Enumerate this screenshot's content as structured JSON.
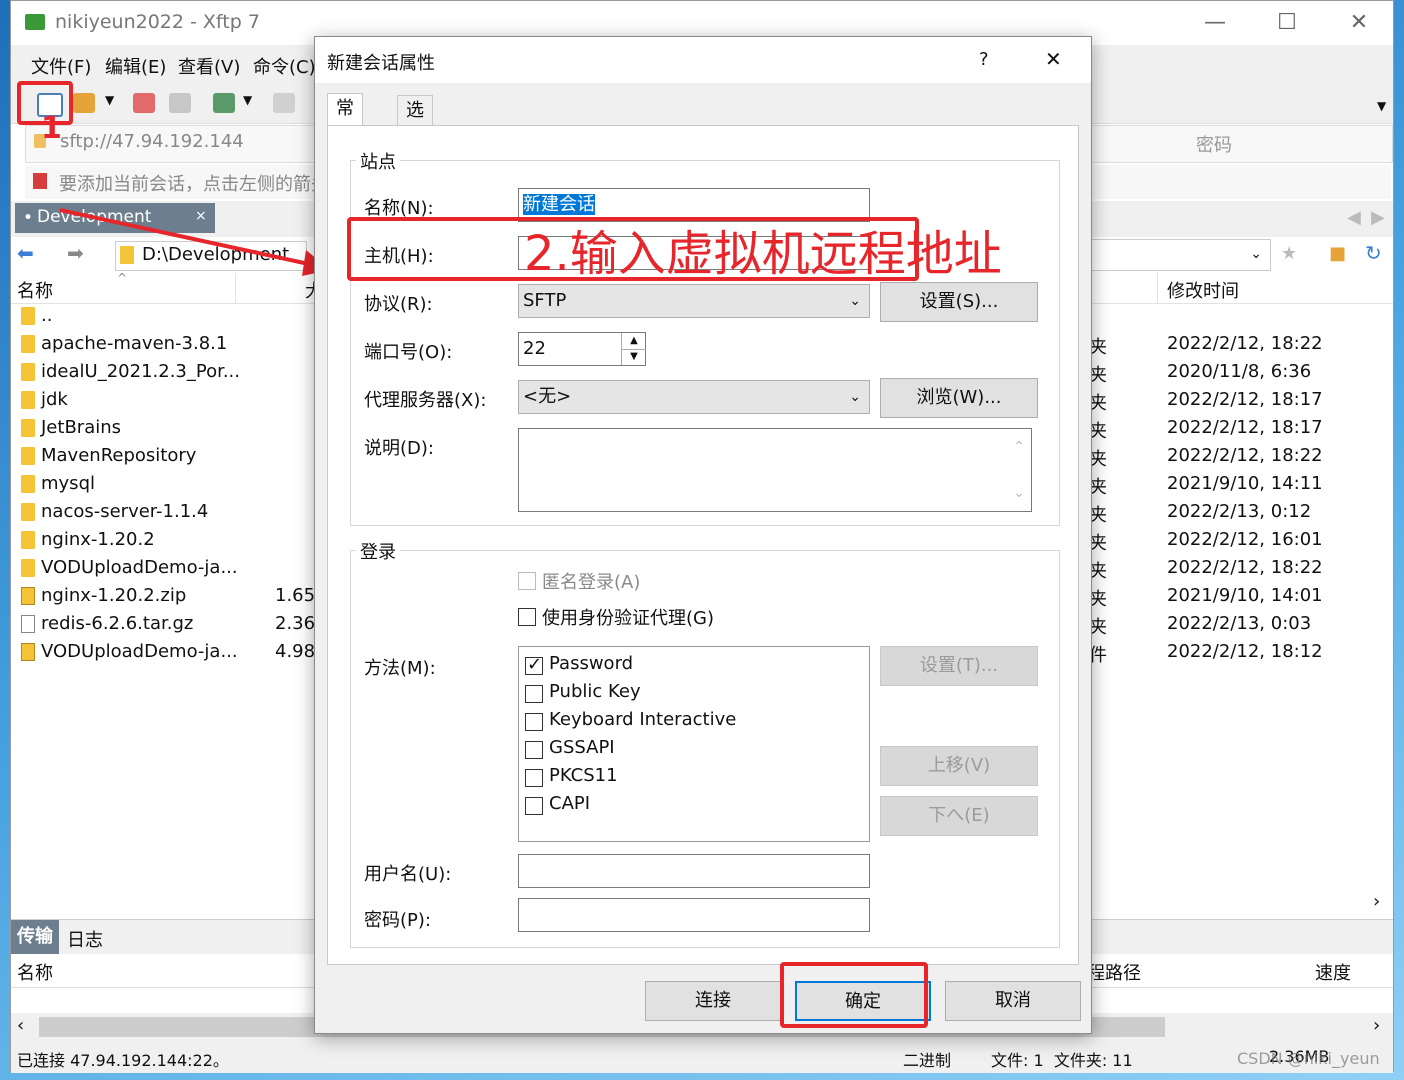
{
  "window": {
    "title": "nikiyeun2022 - Xftp 7",
    "minimize": "—",
    "maximize": "☐",
    "close": "✕"
  },
  "menu": [
    "文件(F)",
    "编辑(E)",
    "查看(V)",
    "命令(C)"
  ],
  "address": {
    "value": "sftp://47.94.192.144",
    "password_placeholder": "密码"
  },
  "info_bar": "要添加当前会话，点击左侧的箭头",
  "session_tab": {
    "label": "Development",
    "close": "×"
  },
  "path": "D:\\Development",
  "left_columns": {
    "name": "名称",
    "size": "大"
  },
  "right_columns": {
    "modified": "修改时间"
  },
  "files": [
    {
      "name": "..",
      "size": "",
      "type": "",
      "modified": "",
      "icon": "folder"
    },
    {
      "name": "apache-maven-3.8.1",
      "size": "",
      "type": "夹",
      "modified": "2022/2/12, 18:22",
      "icon": "folder"
    },
    {
      "name": "idealU_2021.2.3_Por...",
      "size": "",
      "type": "夹",
      "modified": "2020/11/8, 6:36",
      "icon": "folder"
    },
    {
      "name": "jdk",
      "size": "",
      "type": "夹",
      "modified": "2022/2/12, 18:17",
      "icon": "folder"
    },
    {
      "name": "JetBrains",
      "size": "",
      "type": "夹",
      "modified": "2022/2/12, 18:17",
      "icon": "folder"
    },
    {
      "name": "MavenRepository",
      "size": "",
      "type": "夹",
      "modified": "2022/2/12, 18:22",
      "icon": "folder"
    },
    {
      "name": "mysql",
      "size": "",
      "type": "夹",
      "modified": "2021/9/10, 14:11",
      "icon": "folder"
    },
    {
      "name": "nacos-server-1.1.4",
      "size": "",
      "type": "夹",
      "modified": "2022/2/13, 0:12",
      "icon": "folder"
    },
    {
      "name": "nginx-1.20.2",
      "size": "",
      "type": "夹",
      "modified": "2022/2/12, 16:01",
      "icon": "folder"
    },
    {
      "name": "VODUploadDemo-ja...",
      "size": "",
      "type": "夹",
      "modified": "2022/2/12, 18:22",
      "icon": "folder"
    },
    {
      "name": "nginx-1.20.2.zip",
      "size": "1.65",
      "type": "夹",
      "modified": "2021/9/10, 14:01",
      "icon": "zip"
    },
    {
      "name": "redis-6.2.6.tar.gz",
      "size": "2.36",
      "type": "夹",
      "modified": "2022/2/13, 0:03",
      "icon": "file"
    },
    {
      "name": "VODUploadDemo-ja...",
      "size": "4.98",
      "type": "件",
      "modified": "2022/2/12, 18:12",
      "icon": "zip"
    }
  ],
  "bottom_tabs": [
    "传输",
    "日志"
  ],
  "transfer_columns": {
    "name": "名称",
    "path": "程路径",
    "speed": "速度"
  },
  "status": {
    "connected": "已连接 47.94.192.144:22。",
    "mode": "二进制",
    "counts": "文件: 1  文件夹: 11",
    "size": "2.36MB"
  },
  "watermark": "CSDN @niki_yeun",
  "annotations": {
    "step1": "1",
    "step2": "2.输入虚拟机远程地址"
  },
  "dialog": {
    "title": "新建会话属性",
    "help": "?",
    "close": "✕",
    "tabs": [
      "常规",
      "选项"
    ],
    "site_group": "站点",
    "name_label": "名称(N):",
    "name_value": "新建会话",
    "host_label": "主机(H):",
    "host_value": "",
    "protocol_label": "协议(R):",
    "protocol_value": "SFTP",
    "protocol_settings": "设置(S)...",
    "port_label": "端口号(O):",
    "port_value": "22",
    "proxy_label": "代理服务器(X):",
    "proxy_value": "<无>",
    "proxy_browse": "浏览(W)...",
    "desc_label": "说明(D):",
    "login_group": "登录",
    "anonymous": "匿名登录(A)",
    "use_agent": "使用身份验证代理(G)",
    "method_label": "方法(M):",
    "methods": [
      {
        "label": "Password",
        "checked": true
      },
      {
        "label": "Public Key",
        "checked": false
      },
      {
        "label": "Keyboard Interactive",
        "checked": false
      },
      {
        "label": "GSSAPI",
        "checked": false
      },
      {
        "label": "PKCS11",
        "checked": false
      },
      {
        "label": "CAPI",
        "checked": false
      }
    ],
    "method_settings": "设置(T)...",
    "move_up": "上移(V)",
    "move_down": "下へ(E)",
    "username_label": "用户名(U):",
    "password_label": "密码(P):",
    "connect": "连接",
    "ok": "确定",
    "cancel": "取消"
  }
}
